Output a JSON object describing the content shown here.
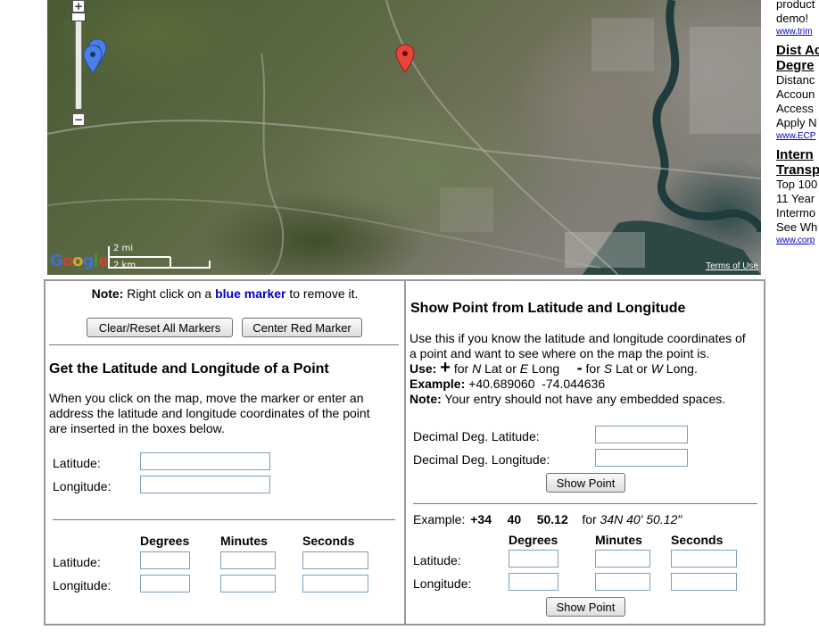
{
  "map": {
    "terms_label": "Terms of Use",
    "scale_mi": "2 mi",
    "scale_km": "2 km",
    "logo_text": "Google",
    "zoom_in_label": "+",
    "zoom_out_label": "−",
    "markers": [
      {
        "color": "blue"
      },
      {
        "color": "blue"
      },
      {
        "color": "red"
      }
    ],
    "colors": {
      "red_marker": "#e8443a",
      "blue_marker": "#4a7fe6"
    }
  },
  "ads": {
    "top_lines": [
      "product",
      "demo!"
    ],
    "top_url": "www.trim",
    "items": [
      {
        "title": [
          "Dist Ac",
          "Degre"
        ],
        "lines": [
          "Distanc",
          "Accoun",
          "Access",
          "Apply N"
        ],
        "url": "www.ECP"
      },
      {
        "title": [
          "Intern",
          "Transp"
        ],
        "lines": [
          "Top 100",
          "11 Year",
          "Intermo",
          "See Wh"
        ],
        "url": "www.corp"
      }
    ]
  },
  "left_panel": {
    "note_label": "Note:",
    "note_pre": "Right click on a",
    "note_marker": "blue marker",
    "note_post": "to remove it.",
    "clear_button": "Clear/Reset All Markers",
    "center_button": "Center Red Marker",
    "heading": "Get the Latitude and Longitude of a Point",
    "description": "When you click on the map, move the marker or enter an address the latitude and longitude coordinates of the point are inserted in the boxes below.",
    "desc_lines": [
      "When you click on the map, move the marker or enter an",
      "address the latitude and longitude coordinates of the point",
      "are inserted in the boxes below."
    ],
    "latitude_label": "Latitude:",
    "longitude_label": "Longitude:",
    "latitude_value": "",
    "longitude_value": "",
    "col_degrees": "Degrees",
    "col_minutes": "Minutes",
    "col_seconds": "Seconds",
    "dms_latitude_label": "Latitude:",
    "dms_longitude_label": "Longitude:"
  },
  "right_panel": {
    "heading": "Show Point from Latitude and Longitude",
    "desc_lines": [
      "Use this if you know the latitude and longitude coordinates of",
      "a point and want to see where on the map the point is."
    ],
    "use_label": "Use:",
    "use_plus": "+",
    "use_plus_text_pre": "for",
    "use_n": "N",
    "use_mid1": "Lat or",
    "use_e": "E",
    "use_mid2": "Long",
    "use_minus": "-",
    "use_minus_text_pre": "for",
    "use_s": "S",
    "use_mid3": "Lat or",
    "use_w": "W",
    "use_end": "Long.",
    "example_label": "Example:",
    "example_value": "+40.689060  -74.044636",
    "note_label": "Note:",
    "note_text": "Your entry should not have any embedded spaces.",
    "dec_lat_label": "Decimal Deg. Latitude:",
    "dec_lon_label": "Decimal Deg. Longitude:",
    "show_point_button": "Show Point",
    "example2_label": "Example:",
    "example2_deg": "+34",
    "example2_min": "40",
    "example2_sec": "50.12",
    "example2_for": "for",
    "example2_dms": "34N 40' 50.12\"",
    "col_degrees": "Degrees",
    "col_minutes": "Minutes",
    "col_seconds": "Seconds",
    "dms_latitude_label": "Latitude:",
    "dms_longitude_label": "Longitude:",
    "show_point_button2": "Show Point"
  }
}
